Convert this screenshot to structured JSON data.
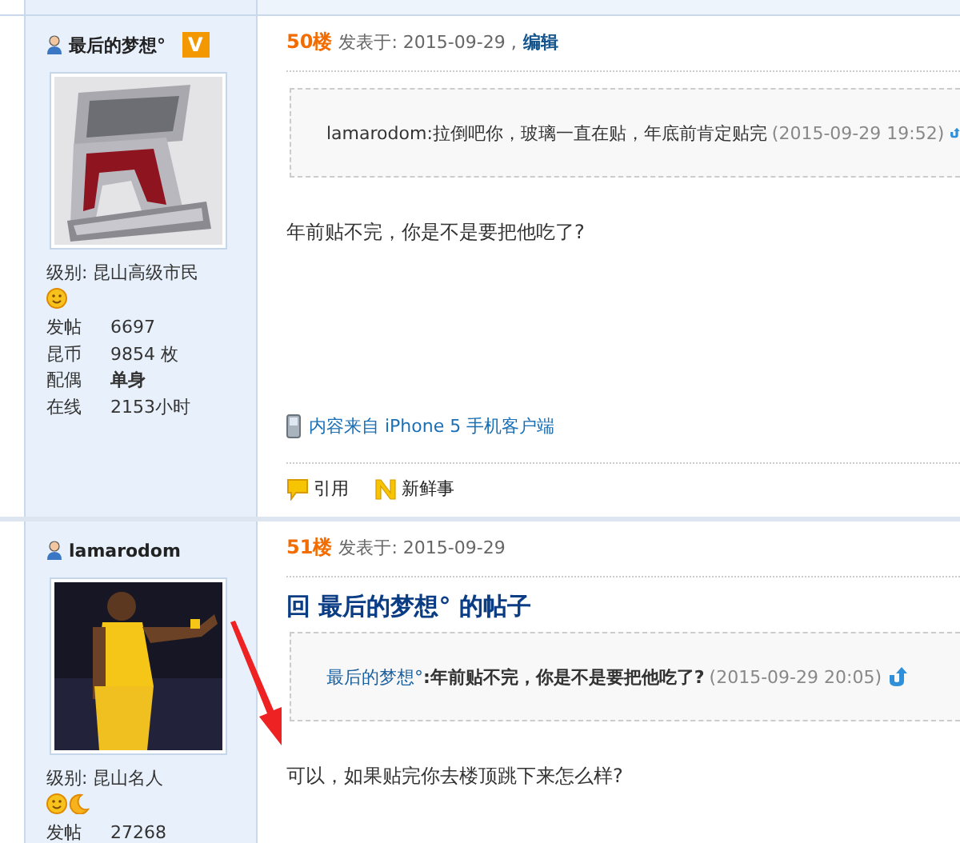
{
  "posts": [
    {
      "user": {
        "name": "最后的梦想°",
        "badge": "V",
        "level": "级别: 昆山高级市民",
        "level_icons": [
          {
            "kind": "sun"
          }
        ],
        "stats": [
          {
            "label": "发帖",
            "value": "6697",
            "bold": false
          },
          {
            "label": "昆币",
            "value": "9854 枚",
            "bold": false
          },
          {
            "label": "配偶",
            "value": "单身",
            "bold": true
          },
          {
            "label": "在线",
            "value": "2153小时",
            "bold": false
          }
        ]
      },
      "floor": "50楼",
      "posted": "发表于: 2015-09-29 ,",
      "edit_link": "编辑",
      "quote": {
        "text": "lamarodom:拉倒吧你，玻璃一直在贴，年底前肯定贴完",
        "time": "(2015-09-29 19:52)"
      },
      "body": "年前贴不完，你是不是要把他吃了?",
      "source": "内容来自 iPhone 5 手机客户端",
      "actions": [
        {
          "kind": "quote",
          "label": "引用"
        },
        {
          "kind": "news",
          "label": "新鲜事"
        }
      ]
    },
    {
      "user": {
        "name": "lamarodom",
        "level": "级别: 昆山名人",
        "level_icons": [
          {
            "kind": "sun"
          },
          {
            "kind": "moon"
          }
        ],
        "stats": [
          {
            "label": "发帖",
            "value": "27268",
            "bold": false
          }
        ]
      },
      "floor": "51楼",
      "posted": "发表于: 2015-09-29",
      "title": "回 最后的梦想° 的帖子",
      "quote": {
        "author": "最后的梦想°",
        "text": ":年前贴不完，你是不是要把他吃了?",
        "time": "(2015-09-29 20:05)"
      },
      "body": "可以，如果贴完你去楼顶跳下来怎么样?"
    }
  ]
}
